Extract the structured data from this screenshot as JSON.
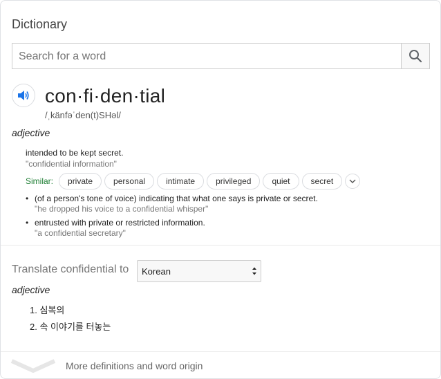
{
  "panel": {
    "title": "Dictionary"
  },
  "search": {
    "placeholder": "Search for a word",
    "icon": "search-icon"
  },
  "entry": {
    "word": "con·fi·den·tial",
    "phonetic": "/ˌkänfəˈden(t)SHəl/",
    "part_of_speech": "adjective",
    "definitions": [
      {
        "text": "intended to be kept secret.",
        "example": "\"confidential information\""
      },
      {
        "text": "(of a person's tone of voice) indicating that what one says is private or secret.",
        "example": "\"he dropped his voice to a confidential whisper\""
      },
      {
        "text": "entrusted with private or restricted information.",
        "example": "\"a confidential secretary\""
      }
    ],
    "similar_label": "Similar:",
    "similar": [
      "private",
      "personal",
      "intimate",
      "privileged",
      "quiet",
      "secret"
    ]
  },
  "translate": {
    "label": "Translate confidential to",
    "language": "Korean",
    "part_of_speech": "adjective",
    "items": [
      "1. 심복의",
      "2. 속 이야기를 터놓는"
    ]
  },
  "footer": {
    "more_label": "More definitions and word origin"
  },
  "colors": {
    "accent_blue": "#1a73e8",
    "similar_green": "#1e7e34",
    "example_gray": "#777777"
  }
}
